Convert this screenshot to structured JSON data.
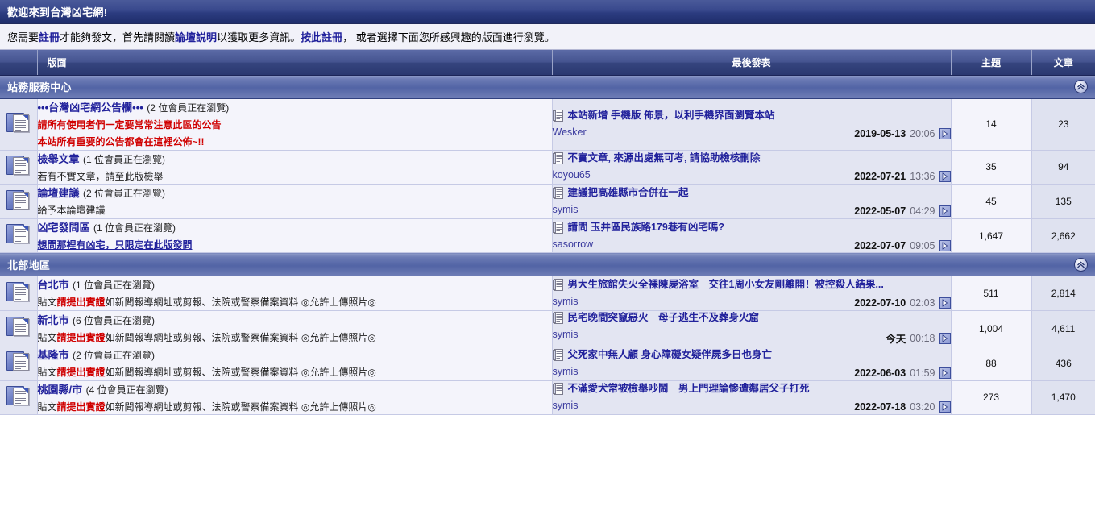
{
  "welcome": {
    "title": "歡迎來到台灣凶宅網!"
  },
  "notice": {
    "part1": "您需要",
    "link_register": "註冊",
    "part2": "才能夠發文，首先請閱讀",
    "link_faq": "論壇説明",
    "part3": "以獲取更多資訊。",
    "link_register_here": "按此註冊",
    "part4": "， 或者選擇下面您所感興趣的版面進行瀏覽。"
  },
  "columns": {
    "icon": "",
    "forum": "版面",
    "lastpost": "最後發表",
    "topics": "主題",
    "posts": "文章"
  },
  "icons": {
    "collapse": "collapse-icon",
    "folder": "forum-folder-icon",
    "doc": "post-doc-icon",
    "goto": "goto-last-post-icon"
  },
  "colors": {
    "header_blue": "#2c3c80",
    "category_blue": "#5264a5",
    "link": "#22229c",
    "alert_red": "#d00000",
    "row_light": "#f4f4fb",
    "row_alt": "#e3e5f2"
  },
  "sections": [
    {
      "title": "站務服務中心",
      "forums": [
        {
          "name": "•••台灣凶宅網公告欄•••",
          "viewing": "(2 位會員正在瀏覽)",
          "desc_lines": [
            {
              "text": "請所有使用者們一定要常常注意此區的公告",
              "style": "red"
            },
            {
              "text": "本站所有重要的公告都會在這裡公佈~!!",
              "style": "red"
            }
          ],
          "last_post": {
            "title": "本站新增 手機版 佈景，以利手機界面瀏覽本站",
            "author": "Wesker",
            "date": "2019-05-13",
            "time": "20:06"
          },
          "topics": "14",
          "posts": "23"
        },
        {
          "name": "檢舉文章",
          "viewing": "(1 位會員正在瀏覽)",
          "desc_lines": [
            {
              "text": "若有不實文章，請至此版檢舉",
              "style": "normal"
            }
          ],
          "last_post": {
            "title": "不實文章, 來源出處無可考, 請協助檢核刪除",
            "author": "koyou65",
            "date": "2022-07-21",
            "time": "13:36"
          },
          "topics": "35",
          "posts": "94"
        },
        {
          "name": "論壇建議",
          "viewing": "(2 位會員正在瀏覽)",
          "desc_lines": [
            {
              "text": "給予本論壇建議",
              "style": "normal"
            }
          ],
          "last_post": {
            "title": "建議把高雄縣市合併在一起",
            "author": "symis",
            "date": "2022-05-07",
            "time": "04:29"
          },
          "topics": "45",
          "posts": "135"
        },
        {
          "name": "凶宅發問區",
          "viewing": "(1 位會員正在瀏覽)",
          "desc_lines": [
            {
              "text": "想問那裡有凶宅，只限定在此版發問",
              "style": "ulink"
            }
          ],
          "last_post": {
            "title": "請問 玉井區民族路179巷有凶宅嗎?",
            "author": "sasorrow",
            "date": "2022-07-07",
            "time": "09:05"
          },
          "topics": "1,647",
          "posts": "2,662"
        }
      ]
    },
    {
      "title": "北部地區",
      "forums": [
        {
          "name": "台北市",
          "viewing": "(1 位會員正在瀏覽)",
          "desc_lines": [
            {
              "text": "貼文",
              "style": "normal",
              "red": "請提出實證",
              "after": "如新聞報導網址或剪報、法院或警察備案資料 ◎允許上傳照片◎"
            }
          ],
          "last_post": {
            "title": "男大生旅館失火全裸陳屍浴室　交往1周小女友剛離開！被控殺人結果...",
            "author": "symis",
            "date": "2022-07-10",
            "time": "02:03"
          },
          "topics": "511",
          "posts": "2,814"
        },
        {
          "name": "新北市",
          "viewing": "(6 位會員正在瀏覽)",
          "desc_lines": [
            {
              "text": "貼文",
              "style": "normal",
              "red": "請提出實證",
              "after": "如新聞報導網址或剪報、法院或警察備案資料 ◎允許上傳照片◎"
            }
          ],
          "last_post": {
            "title": "民宅晚間突竄惡火　母子逃生不及葬身火窟",
            "author": "symis",
            "date": "今天",
            "time": "00:18"
          },
          "topics": "1,004",
          "posts": "4,611"
        },
        {
          "name": "基隆市",
          "viewing": "(2 位會員正在瀏覽)",
          "desc_lines": [
            {
              "text": "貼文",
              "style": "normal",
              "red": "請提出實證",
              "after": "如新聞報導網址或剪報、法院或警察備案資料 ◎允許上傳照片◎"
            }
          ],
          "last_post": {
            "title": "父死家中無人顧 身心障礙女疑伴屍多日也身亡",
            "author": "symis",
            "date": "2022-06-03",
            "time": "01:59"
          },
          "topics": "88",
          "posts": "436"
        },
        {
          "name": "桃園縣/市",
          "viewing": "(4 位會員正在瀏覽)",
          "desc_lines": [
            {
              "text": "貼文",
              "style": "normal",
              "red": "請提出實證",
              "after": "如新聞報導網址或剪報、法院或警察備案資料 ◎允許上傳照片◎"
            }
          ],
          "last_post": {
            "title": "不滿愛犬常被檢舉吵鬧　男上門理論慘遭鄰居父子打死",
            "author": "symis",
            "date": "2022-07-18",
            "time": "03:20"
          },
          "topics": "273",
          "posts": "1,470"
        }
      ]
    }
  ]
}
